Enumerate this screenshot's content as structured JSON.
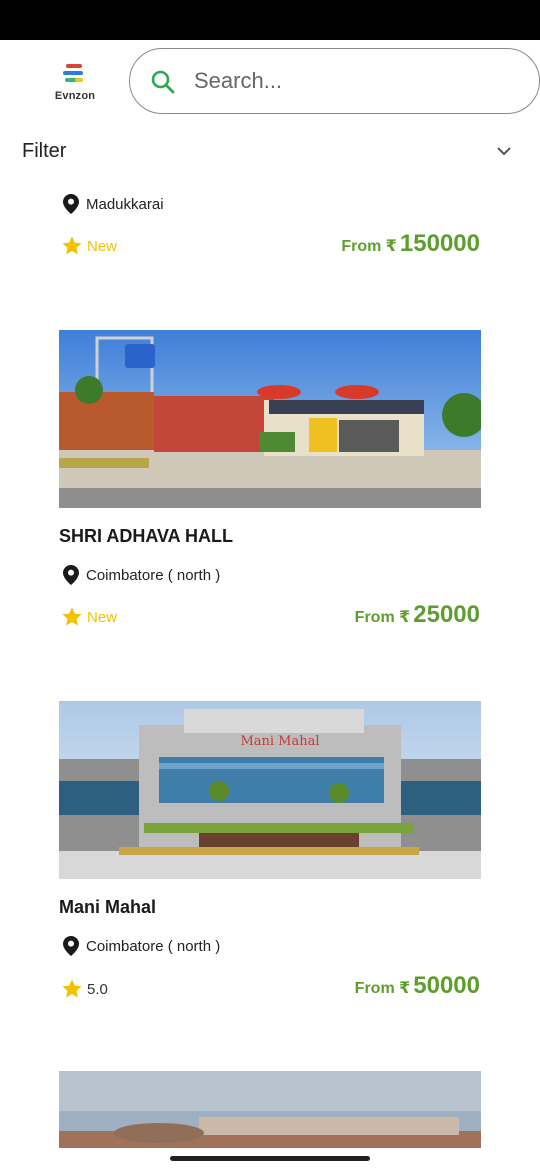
{
  "app": {
    "logo_text": "Evnzon"
  },
  "search": {
    "placeholder": "Search..."
  },
  "filter": {
    "label": "Filter"
  },
  "venues": [
    {
      "name": "",
      "location": "Madukkarai",
      "rating": "New",
      "price_prefix": "From ₹",
      "price": "150000"
    },
    {
      "name": "SHRI  ADHAVA  HALL",
      "location": "Coimbatore ( north )",
      "rating": "New",
      "price_prefix": "From ₹",
      "price": "25000"
    },
    {
      "name": "Mani Mahal",
      "location": "Coimbatore ( north )",
      "rating": "5.0",
      "price_prefix": "From ₹",
      "price": "50000",
      "sign_text": "Mani Mahal"
    },
    {
      "name": "",
      "location": "",
      "rating": "",
      "price_prefix": "",
      "price": ""
    }
  ],
  "colors": {
    "accent": "#5e9e2e",
    "star": "#f2c200",
    "search_icon": "#2fa84f"
  },
  "icons": {
    "search": "search-icon",
    "location": "location-pin-icon",
    "star": "star-icon",
    "chevron": "chevron-down-icon"
  }
}
